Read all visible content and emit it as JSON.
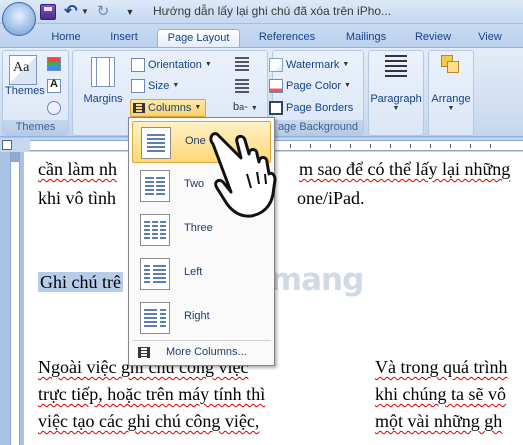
{
  "window": {
    "title": "Hướng dẫn lấy lại ghi chú đã xóa trên iPho..."
  },
  "tabs": [
    "Home",
    "Insert",
    "Page Layout",
    "References",
    "Mailings",
    "Review",
    "View"
  ],
  "ribbon": {
    "themes": {
      "button": "Themes",
      "group_label": "Themes"
    },
    "page_setup": {
      "margins": "Margins",
      "orientation": "Orientation",
      "size": "Size",
      "columns": "Columns"
    },
    "page_background": {
      "watermark": "Watermark",
      "page_color": "Page Color",
      "page_borders": "Page Borders",
      "group_label": "age Background"
    },
    "paragraph": "Paragraph",
    "arrange": "Arrange"
  },
  "columns_menu": {
    "items": [
      "One",
      "Two",
      "Three",
      "Left",
      "Right"
    ],
    "selected": "One",
    "more": "More Columns..."
  },
  "document": {
    "line1_a": "cần làm nh",
    "line1_b": "m sao để có thể lấy lại những",
    "line2_a": "khi vô tình",
    "line2_b": "one/iPad.",
    "heading": "Ghi chú trê",
    "col1": [
      "Ngoài việc ghi chú công việc",
      "trực tiếp, hoặc trên máy tính thì",
      "việc tạo các ghi chú công việc,"
    ],
    "col2": [
      "Và trong quá trình",
      "khi chúng ta sẽ vô",
      "một vài những gh"
    ]
  },
  "watermark_text": "uantrimang",
  "accent_colors": {
    "ribbon_text": "#15428b",
    "highlight": "#ffd776",
    "spelling": "#dd0000"
  }
}
